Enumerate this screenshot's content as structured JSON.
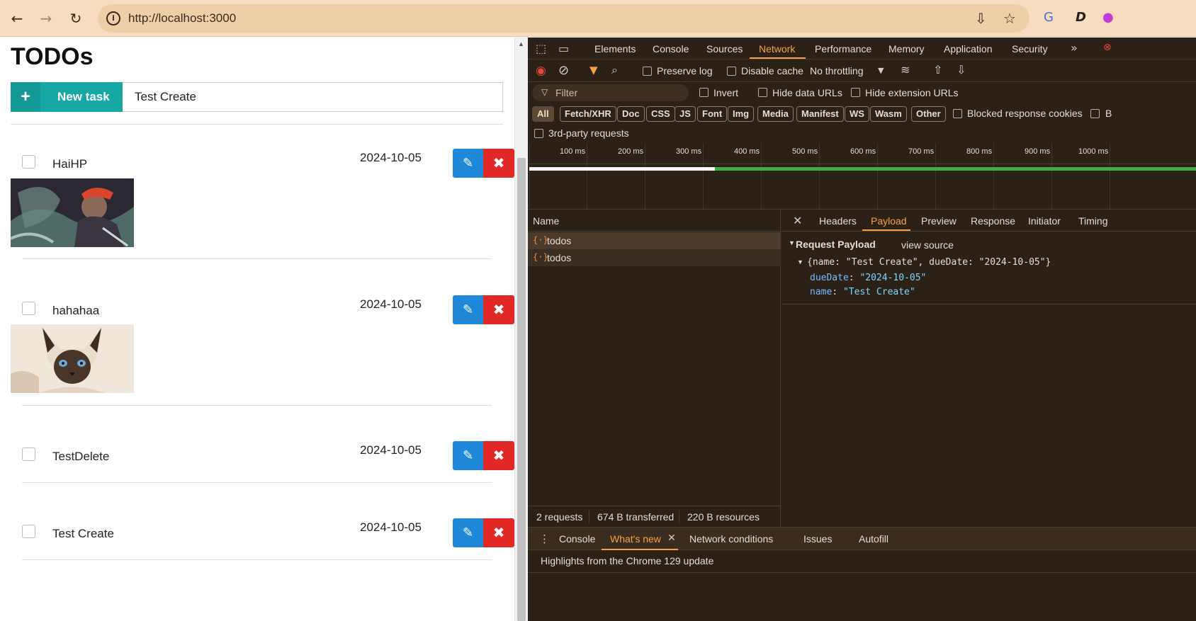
{
  "browser": {
    "url": "http://localhost:3000"
  },
  "page": {
    "title": "TODOs",
    "new_task_label": "New task",
    "new_task_input_value": "Test Create",
    "todos": [
      {
        "name": "HaiHP",
        "date": "2024-10-05",
        "has_image": true,
        "image": "warrior-artwork"
      },
      {
        "name": "hahahaa",
        "date": "2024-10-05",
        "has_image": true,
        "image": "siamese-cat-photo"
      },
      {
        "name": "TestDelete",
        "date": "2024-10-05",
        "has_image": false
      },
      {
        "name": "Test Create",
        "date": "2024-10-05",
        "has_image": false
      }
    ]
  },
  "devtools": {
    "tabs": [
      "Elements",
      "Console",
      "Sources",
      "Network",
      "Performance",
      "Memory",
      "Application",
      "Security"
    ],
    "active_tab": "Network",
    "toolbar": {
      "preserve_log": "Preserve log",
      "disable_cache": "Disable cache",
      "throttling": "No throttling"
    },
    "filter": {
      "placeholder": "Filter",
      "invert": "Invert",
      "hide_data_urls": "Hide data URLs",
      "hide_extension_urls": "Hide extension URLs"
    },
    "type_chips": [
      "All",
      "Fetch/XHR",
      "Doc",
      "CSS",
      "JS",
      "Font",
      "Img",
      "Media",
      "Manifest",
      "WS",
      "Wasm",
      "Other"
    ],
    "blocked_cookies": "Blocked response cookies",
    "blocked_requests_partial": "B",
    "third_party": "3rd-party requests",
    "timeline_ticks": [
      "100 ms",
      "200 ms",
      "300 ms",
      "400 ms",
      "500 ms",
      "600 ms",
      "700 ms",
      "800 ms",
      "900 ms",
      "1000 ms"
    ],
    "requests": {
      "column_name": "Name",
      "items": [
        "todos",
        "todos"
      ]
    },
    "detail": {
      "tabs": [
        "Headers",
        "Payload",
        "Preview",
        "Response",
        "Initiator",
        "Timing"
      ],
      "active_tab": "Payload",
      "section_title": "Request Payload",
      "view_source": "view source",
      "summary": "{name: \"Test Create\", dueDate: \"2024-10-05\"}",
      "fields": [
        {
          "key": "dueDate",
          "value": "\"2024-10-05\""
        },
        {
          "key": "name",
          "value": "\"Test Create\""
        }
      ]
    },
    "status": {
      "requests": "2 requests",
      "transferred": "674 B transferred",
      "resources": "220 B resources"
    },
    "drawer": {
      "tabs": [
        "Console",
        "What's new",
        "Network conditions",
        "Issues",
        "Autofill"
      ],
      "active_tab": "What's new",
      "body_text": "Highlights from the Chrome 129 update"
    },
    "colors": {
      "accent": "#f3a24b",
      "background": "#2b2117"
    }
  },
  "colors": {
    "teal": "#17a8a6",
    "edit_blue": "#1f88d8",
    "delete_red": "#e22727",
    "browser_bar": "#f7dcc0"
  }
}
